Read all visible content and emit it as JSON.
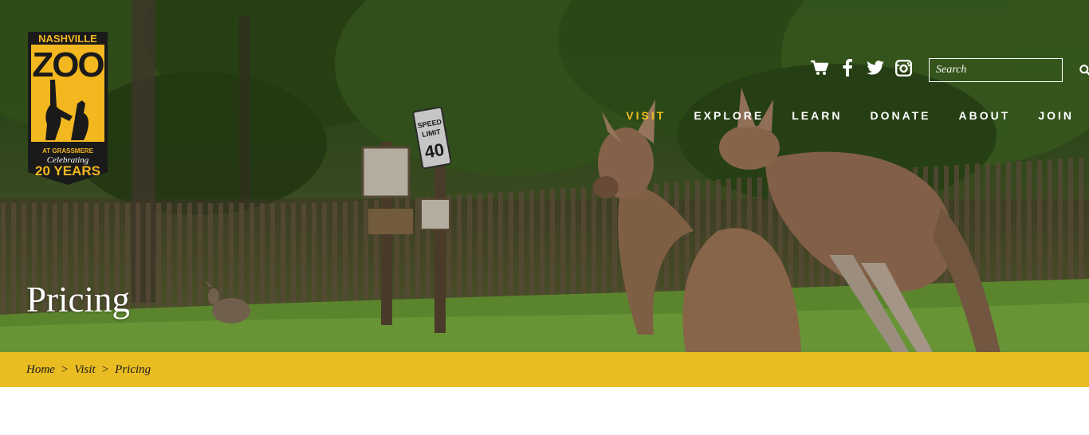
{
  "logo": {
    "line1": "NASHVILLE",
    "line2": "ZOO",
    "line3": "AT GRASSMERE",
    "line4": "Celebrating",
    "line5": "20 YEARS"
  },
  "utility": {
    "icons": [
      "cart-icon",
      "facebook-icon",
      "twitter-icon",
      "instagram-icon"
    ]
  },
  "search": {
    "placeholder": "Search"
  },
  "nav": {
    "items": [
      {
        "label": "VISIT",
        "active": true
      },
      {
        "label": "EXPLORE"
      },
      {
        "label": "LEARN"
      },
      {
        "label": "DONATE"
      },
      {
        "label": "ABOUT"
      },
      {
        "label": "JOIN"
      }
    ]
  },
  "hero": {
    "title": "Pricing",
    "sign": {
      "line1": "SPEED",
      "line2": "LIMIT",
      "value": "40"
    }
  },
  "breadcrumb": {
    "items": [
      "Home",
      "Visit",
      "Pricing"
    ],
    "separator": ">"
  },
  "colors": {
    "accent": "#f0bd1e",
    "breadcrumb_bg": "#e9bc22",
    "white": "#ffffff"
  }
}
